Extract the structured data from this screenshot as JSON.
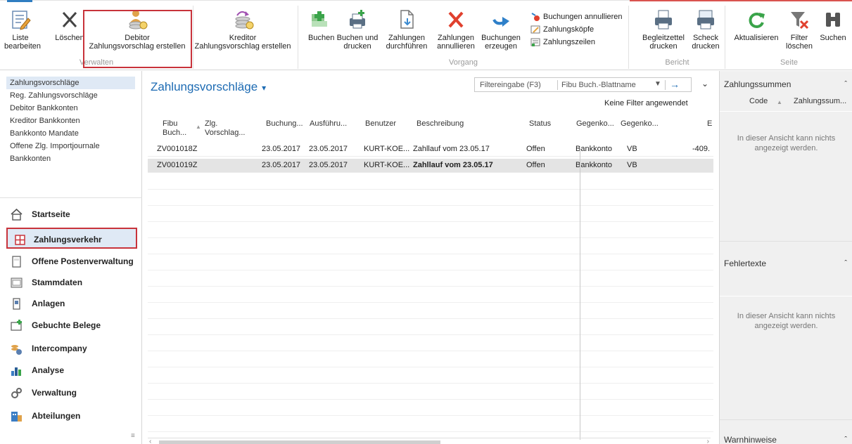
{
  "ribbon": {
    "groups": {
      "verwalten": "Verwalten",
      "vorgang": "Vorgang",
      "bericht": "Bericht",
      "seite": "Seite"
    },
    "buttons": {
      "liste_bearbeiten": "Liste\nbearbeiten",
      "loeschen": "Löschen",
      "debitor_vorschlag": "Debitor\nZahlungsvorschlag erstellen",
      "kreditor_vorschlag": "Kreditor\nZahlungsvorschlag erstellen",
      "buchen": "Buchen",
      "buchen_drucken": "Buchen und\ndrucken",
      "zahlungen_durchfuehren": "Zahlungen\ndurchführen",
      "zahlungen_annullieren": "Zahlungen\nannullieren",
      "buchungen_erzeugen": "Buchungen\nerzeugen",
      "buchungen_annullieren": "Buchungen annullieren",
      "zahlungskoepfe": "Zahlungsköpfe",
      "zahlungszeilen": "Zahlungszeilen",
      "begleitzettel": "Begleitzettel\ndrucken",
      "scheck": "Scheck\ndrucken",
      "aktualisieren": "Aktualisieren",
      "filter_loeschen": "Filter\nlöschen",
      "suchen": "Suchen"
    }
  },
  "leftnav": {
    "links": [
      "Zahlungsvorschläge",
      "Reg. Zahlungsvorschläge",
      "Debitor Bankkonten",
      "Kreditor Bankkonten",
      "Bankkonto Mandate",
      "Offene Zlg. Importjournale",
      "Bankkonten"
    ],
    "areas": [
      "Startseite",
      "Zahlungsverkehr",
      "Offene Postenverwaltung",
      "Stammdaten",
      "Anlagen",
      "Gebuchte Belege",
      "Intercompany",
      "Analyse",
      "Verwaltung",
      "Abteilungen"
    ]
  },
  "main": {
    "title": "Zahlungsvorschläge",
    "filter_placeholder": "Filtereingabe (F3)",
    "filter_field": "Fibu Buch.-Blattname",
    "no_filter": "Keine Filter angewendet",
    "columns": [
      "Fibu\nBuch...",
      "Zlg.\nVorschlag...",
      "Buchung...",
      "Ausführu...",
      "Benutzer",
      "Beschreibung",
      "Status",
      "Gegenko...",
      "Gegenko...",
      "E"
    ],
    "rows": [
      {
        "fibu": "ZV001018Z",
        "buchung": "23.05.2017",
        "ausfuehrung": "23.05.2017",
        "benutzer": "KURT-KOE...",
        "beschreibung": "Zahllauf vom 23.05.17",
        "status": "Offen",
        "gegenko1": "Bankkonto",
        "gegenko2": "VB",
        "betrag": "-409."
      },
      {
        "fibu": "ZV001019Z",
        "buchung": "23.05.2017",
        "ausfuehrung": "23.05.2017",
        "benutzer": "KURT-KOE...",
        "beschreibung": "Zahllauf vom 23.05.17",
        "status": "Offen",
        "gegenko1": "Bankkonto",
        "gegenko2": "VB",
        "betrag": ""
      }
    ]
  },
  "factbox": {
    "summen_title": "Zahlungssummen",
    "summen_cols": [
      "Code",
      "Zahlungssum..."
    ],
    "summen_msg": "In dieser Ansicht kann nichts\nangezeigt werden.",
    "fehler_title": "Fehlertexte",
    "fehler_msg": "In dieser Ansicht kann nichts\nangezeigt werden.",
    "warn_title": "Warnhinweise"
  }
}
